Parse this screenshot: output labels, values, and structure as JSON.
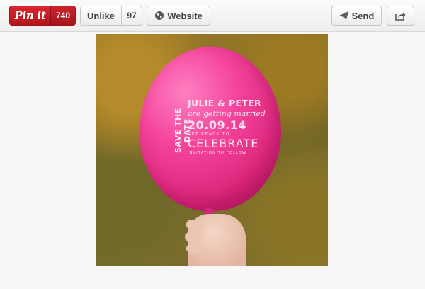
{
  "toolbar": {
    "pin_label": "Pin it",
    "pin_count": "740",
    "unlike_label": "Unlike",
    "like_count": "97",
    "website_label": "Website",
    "send_label": "Send"
  },
  "icons": {
    "website": "globe-icon",
    "send": "paper-plane-icon",
    "share": "share-arrow-icon"
  },
  "colors": {
    "pin_red": "#c8202a",
    "balloon_pink": "#f4439a",
    "page_bg": "#f7f7f7"
  },
  "photo": {
    "balloon_text": {
      "save_the_date": "SAVE THE DATE",
      "names": "JULIE & PETER",
      "subtitle": "are getting married",
      "date": "20.09.14",
      "ready": "GET READY TO",
      "celebrate": "CELEBRATE",
      "invitation": "INVITATION TO FOLLOW"
    }
  }
}
